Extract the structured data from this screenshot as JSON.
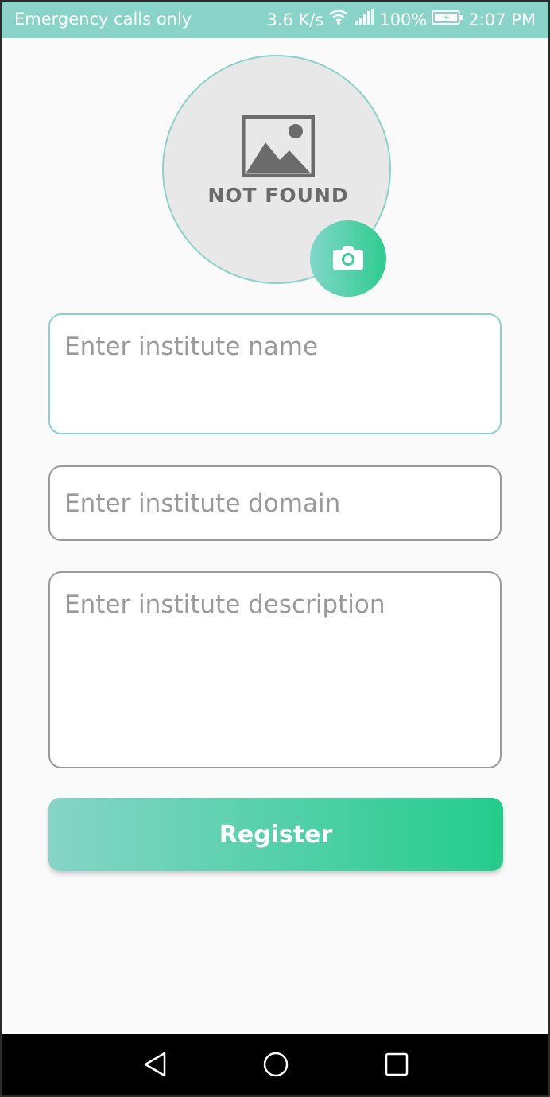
{
  "status_bar": {
    "left_text": "Emergency calls only",
    "speed": "3.6 K/s",
    "battery": "100%",
    "time": "2:07 PM",
    "icons": [
      "wifi-icon",
      "signal-icon",
      "battery-icon"
    ]
  },
  "avatar": {
    "placeholder_text": "NOT FOUND",
    "icon": "image-placeholder-icon",
    "camera_icon": "camera-icon"
  },
  "form": {
    "name_placeholder": "Enter institute name",
    "domain_placeholder": "Enter institute domain",
    "description_placeholder": "Enter institute description",
    "register_label": "Register"
  },
  "nav": {
    "icons": [
      "back-icon",
      "home-icon",
      "recent-apps-icon"
    ]
  },
  "colors": {
    "accent": "#8ad3c9",
    "gradient_start": "#86d5c7",
    "gradient_end": "#24cc8d"
  }
}
